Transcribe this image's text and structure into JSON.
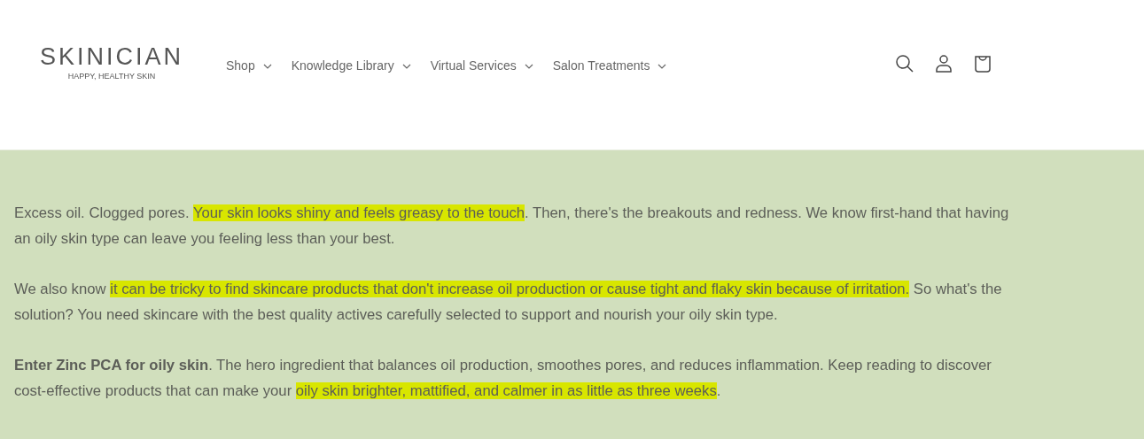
{
  "header": {
    "logo": {
      "name": "SKINICIAN",
      "tagline": "HAPPY, HEALTHY SKIN"
    },
    "nav": [
      {
        "label": "Shop"
      },
      {
        "label": "Knowledge Library"
      },
      {
        "label": "Virtual Services"
      },
      {
        "label": "Salon Treatments"
      }
    ]
  },
  "paragraphs": [
    [
      {
        "text": "Excess oil. Clogged pores. ",
        "highlighted": false
      },
      {
        "text": "Your skin looks shiny and feels greasy to the touch",
        "highlighted": true
      },
      {
        "text": ". Then, there's the breakouts and redness. We know first-hand that having an oily skin type can leave you feeling less than your best.",
        "highlighted": false
      }
    ],
    [
      {
        "text": "We also know ",
        "highlighted": false
      },
      {
        "text": "it can be tricky to find skincare products that don't increase oil production or cause tight and flaky skin because of irritation.",
        "highlighted": true
      },
      {
        "text": " So what's the solution? You need skincare with the best quality actives carefully selected to support and nourish your oily skin type.",
        "highlighted": false
      }
    ],
    [
      {
        "text": "**Enter Zinc PCA for oily skin**. The hero ingredient that balances oil production, smoothes pores, and reduces inflammation. Keep reading to discover cost-effective products that can make your ",
        "highlighted": false
      },
      {
        "text": "oily skin brighter, mattified, and calmer in as little as three weeks",
        "highlighted": true
      },
      {
        "text": ".",
        "highlighted": false
      }
    ]
  ]
}
